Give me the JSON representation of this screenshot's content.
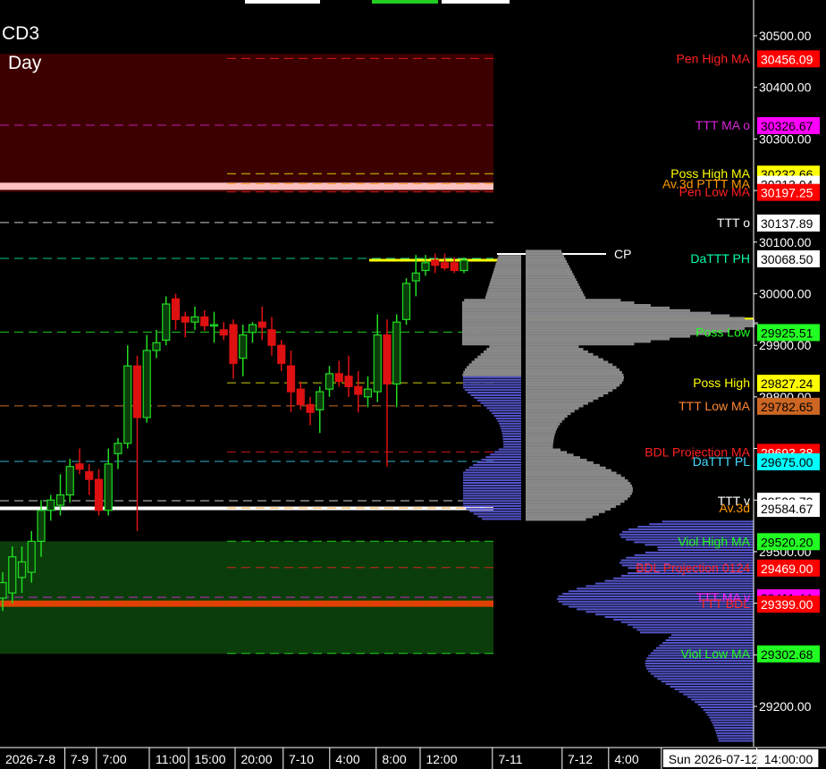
{
  "header": {
    "symbol": "CD3",
    "timeframe": "Day"
  },
  "colors": {
    "background": "#000000",
    "up_candle": "#22dd22",
    "down_candle": "#dd1111",
    "pen_zone": "#3d0000",
    "viol_zone": "#0b3d0b",
    "profile_gray": "#888888",
    "profile_blue": "#5555cc"
  },
  "chart_data": {
    "type": "candlestick",
    "title": "CD3",
    "timeframe": "Day",
    "y_axis": {
      "position": "right",
      "ylim": [
        29140,
        30580
      ],
      "ticks": [
        "30500.00",
        "30400.00",
        "30300.00",
        "30200.00",
        "30100.00",
        "30000.00",
        "29900.00",
        "29800.00",
        "29700.00",
        "29600.00",
        "29500.00",
        "29400.00",
        "29300.00",
        "29200.00"
      ]
    },
    "x_axis": {
      "tick_labels": [
        "2026-7-8",
        "7-9",
        "7:00",
        "11:00",
        "15:00",
        "20:00",
        "7-10",
        "4:00",
        "8:00",
        "12:00",
        "7-11",
        "7-12",
        "4:00",
        "Sun 2026-07-12",
        "14:00:00"
      ]
    },
    "zones": [
      {
        "name": "pen",
        "from": 30465,
        "to": 30197
      },
      {
        "name": "viol",
        "from": 29520,
        "to": 29302
      }
    ],
    "levels": [
      {
        "label": "Pen High MA",
        "value": "30456.09",
        "color": "#ff2020",
        "box": "#ff0000",
        "box_text": "#ffffff"
      },
      {
        "label": "TTT MA o",
        "value": "30326.67",
        "color": "#dd22dd",
        "box": "#ff00ff",
        "box_text": "#000000"
      },
      {
        "label": "Poss High MA",
        "value": "30232.66",
        "color": "#ffff00",
        "box": "#ffff00",
        "box_text": "#000000"
      },
      {
        "label": "Av.3d PTTT MA",
        "value": "30213.04",
        "color": "#ff9900",
        "box": "#ffffff",
        "box_text": "#000000"
      },
      {
        "label": "Pen Low MA",
        "value": "30197.25",
        "color": "#ff2020",
        "box": "#ff0000",
        "box_text": "#ffffff"
      },
      {
        "label": "TTT o",
        "value": "30137.89",
        "color": "#ffffff",
        "box": "#ffffff",
        "box_text": "#000000"
      },
      {
        "label": "DaTTT PH",
        "value": "30068.50",
        "color": "#00ffaa",
        "box": "#ffffff",
        "box_text": "#000000"
      },
      {
        "label": "Poss Low",
        "value": "29925.51",
        "color": "#22ff22",
        "box": "#22ff22",
        "box_text": "#000000"
      },
      {
        "label": "Poss High",
        "value": "29827.24",
        "color": "#ffff00",
        "box": "#ffff00",
        "box_text": "#000000"
      },
      {
        "label": "TTT Low MA",
        "value": "29782.65",
        "color": "#ff8833",
        "box": "#cc6622",
        "box_text": "#000000"
      },
      {
        "label": "BDL Projection MA",
        "value": "29693.38",
        "color": "#ff2020",
        "box": "#ff0000",
        "box_text": "#ffffff"
      },
      {
        "label": "DaTTT PL",
        "value": "29675.00",
        "color": "#44ddff",
        "box": "#00ffff",
        "box_text": "#000000"
      },
      {
        "label": "TTT v",
        "value": "29598.70",
        "color": "#ffffff",
        "box": "#ffffff",
        "box_text": "#000000"
      },
      {
        "label": "Av.3d",
        "value": "29584.67",
        "color": "#ff9900",
        "box": "#ffffff",
        "box_text": "#000000"
      },
      {
        "label": "Viol High MA",
        "value": "29520.20",
        "color": "#22ff22",
        "box": "#22ff22",
        "box_text": "#000000"
      },
      {
        "label": "BDL Projection 0124",
        "value": "29469.00",
        "color": "#ff2020",
        "box": "#ff0000",
        "box_text": "#ffffff"
      },
      {
        "label": "TTT MA v",
        "value": "29411.44",
        "color": "#ff22ff",
        "box": "#ff00ff",
        "box_text": "#000000"
      },
      {
        "label": "TTT BDL",
        "value": "29399.00",
        "color": "#ff2020",
        "box": "#ff0000",
        "box_text": "#ffffff"
      },
      {
        "label": "Viol Low MA",
        "value": "29302.68",
        "color": "#22ff22",
        "box": "#22ff22",
        "box_text": "#000000"
      }
    ],
    "cp_label": "CP",
    "candles": [
      {
        "o": 29410,
        "h": 29460,
        "l": 29385,
        "c": 29440
      },
      {
        "o": 29420,
        "h": 29510,
        "l": 29400,
        "c": 29490
      },
      {
        "o": 29450,
        "h": 29510,
        "l": 29420,
        "c": 29480
      },
      {
        "o": 29460,
        "h": 29540,
        "l": 29440,
        "c": 29520
      },
      {
        "o": 29520,
        "h": 29600,
        "l": 29490,
        "c": 29580
      },
      {
        "o": 29580,
        "h": 29610,
        "l": 29560,
        "c": 29600
      },
      {
        "o": 29590,
        "h": 29650,
        "l": 29570,
        "c": 29610
      },
      {
        "o": 29610,
        "h": 29680,
        "l": 29595,
        "c": 29665
      },
      {
        "o": 29670,
        "h": 29700,
        "l": 29650,
        "c": 29660
      },
      {
        "o": 29655,
        "h": 29670,
        "l": 29610,
        "c": 29640
      },
      {
        "o": 29640,
        "h": 29660,
        "l": 29570,
        "c": 29580
      },
      {
        "o": 29580,
        "h": 29700,
        "l": 29570,
        "c": 29670
      },
      {
        "o": 29690,
        "h": 29720,
        "l": 29660,
        "c": 29710
      },
      {
        "o": 29710,
        "h": 29900,
        "l": 29700,
        "c": 29860
      },
      {
        "o": 29860,
        "h": 29880,
        "l": 29540,
        "c": 29760
      },
      {
        "o": 29760,
        "h": 29920,
        "l": 29750,
        "c": 29890
      },
      {
        "o": 29890,
        "h": 29930,
        "l": 29875,
        "c": 29905
      },
      {
        "o": 29910,
        "h": 29995,
        "l": 29900,
        "c": 29980
      },
      {
        "o": 29990,
        "h": 30000,
        "l": 29930,
        "c": 29950
      },
      {
        "o": 29955,
        "h": 29965,
        "l": 29915,
        "c": 29945
      },
      {
        "o": 29945,
        "h": 29975,
        "l": 29930,
        "c": 29955
      },
      {
        "o": 29955,
        "h": 29968,
        "l": 29928,
        "c": 29938
      },
      {
        "o": 29938,
        "h": 29965,
        "l": 29905,
        "c": 29940
      },
      {
        "o": 29930,
        "h": 29945,
        "l": 29910,
        "c": 29920
      },
      {
        "o": 29940,
        "h": 29950,
        "l": 29835,
        "c": 29865
      },
      {
        "o": 29875,
        "h": 29940,
        "l": 29840,
        "c": 29920
      },
      {
        "o": 29925,
        "h": 29945,
        "l": 29905,
        "c": 29940
      },
      {
        "o": 29945,
        "h": 29975,
        "l": 29910,
        "c": 29935
      },
      {
        "o": 29930,
        "h": 29955,
        "l": 29880,
        "c": 29900
      },
      {
        "o": 29900,
        "h": 29910,
        "l": 29850,
        "c": 29865
      },
      {
        "o": 29860,
        "h": 29890,
        "l": 29770,
        "c": 29810
      },
      {
        "o": 29815,
        "h": 29830,
        "l": 29775,
        "c": 29785
      },
      {
        "o": 29785,
        "h": 29800,
        "l": 29745,
        "c": 29770
      },
      {
        "o": 29775,
        "h": 29820,
        "l": 29730,
        "c": 29810
      },
      {
        "o": 29815,
        "h": 29860,
        "l": 29800,
        "c": 29845
      },
      {
        "o": 29845,
        "h": 29870,
        "l": 29820,
        "c": 29830
      },
      {
        "o": 29840,
        "h": 29880,
        "l": 29800,
        "c": 29820
      },
      {
        "o": 29820,
        "h": 29850,
        "l": 29770,
        "c": 29805
      },
      {
        "o": 29800,
        "h": 29840,
        "l": 29780,
        "c": 29815
      },
      {
        "o": 29810,
        "h": 29960,
        "l": 29790,
        "c": 29920
      },
      {
        "o": 29920,
        "h": 29950,
        "l": 29665,
        "c": 29825
      },
      {
        "o": 29825,
        "h": 29960,
        "l": 29780,
        "c": 29945
      },
      {
        "o": 29950,
        "h": 30030,
        "l": 29940,
        "c": 30020
      },
      {
        "o": 30025,
        "h": 30075,
        "l": 29995,
        "c": 30040
      },
      {
        "o": 30045,
        "h": 30075,
        "l": 30035,
        "c": 30060
      },
      {
        "o": 30065,
        "h": 30078,
        "l": 30040,
        "c": 30055
      },
      {
        "o": 30060,
        "h": 30078,
        "l": 30045,
        "c": 30050
      },
      {
        "o": 30060,
        "h": 30070,
        "l": 30040,
        "c": 30045
      },
      {
        "o": 30045,
        "h": 30070,
        "l": 30040,
        "c": 30065
      }
    ]
  }
}
